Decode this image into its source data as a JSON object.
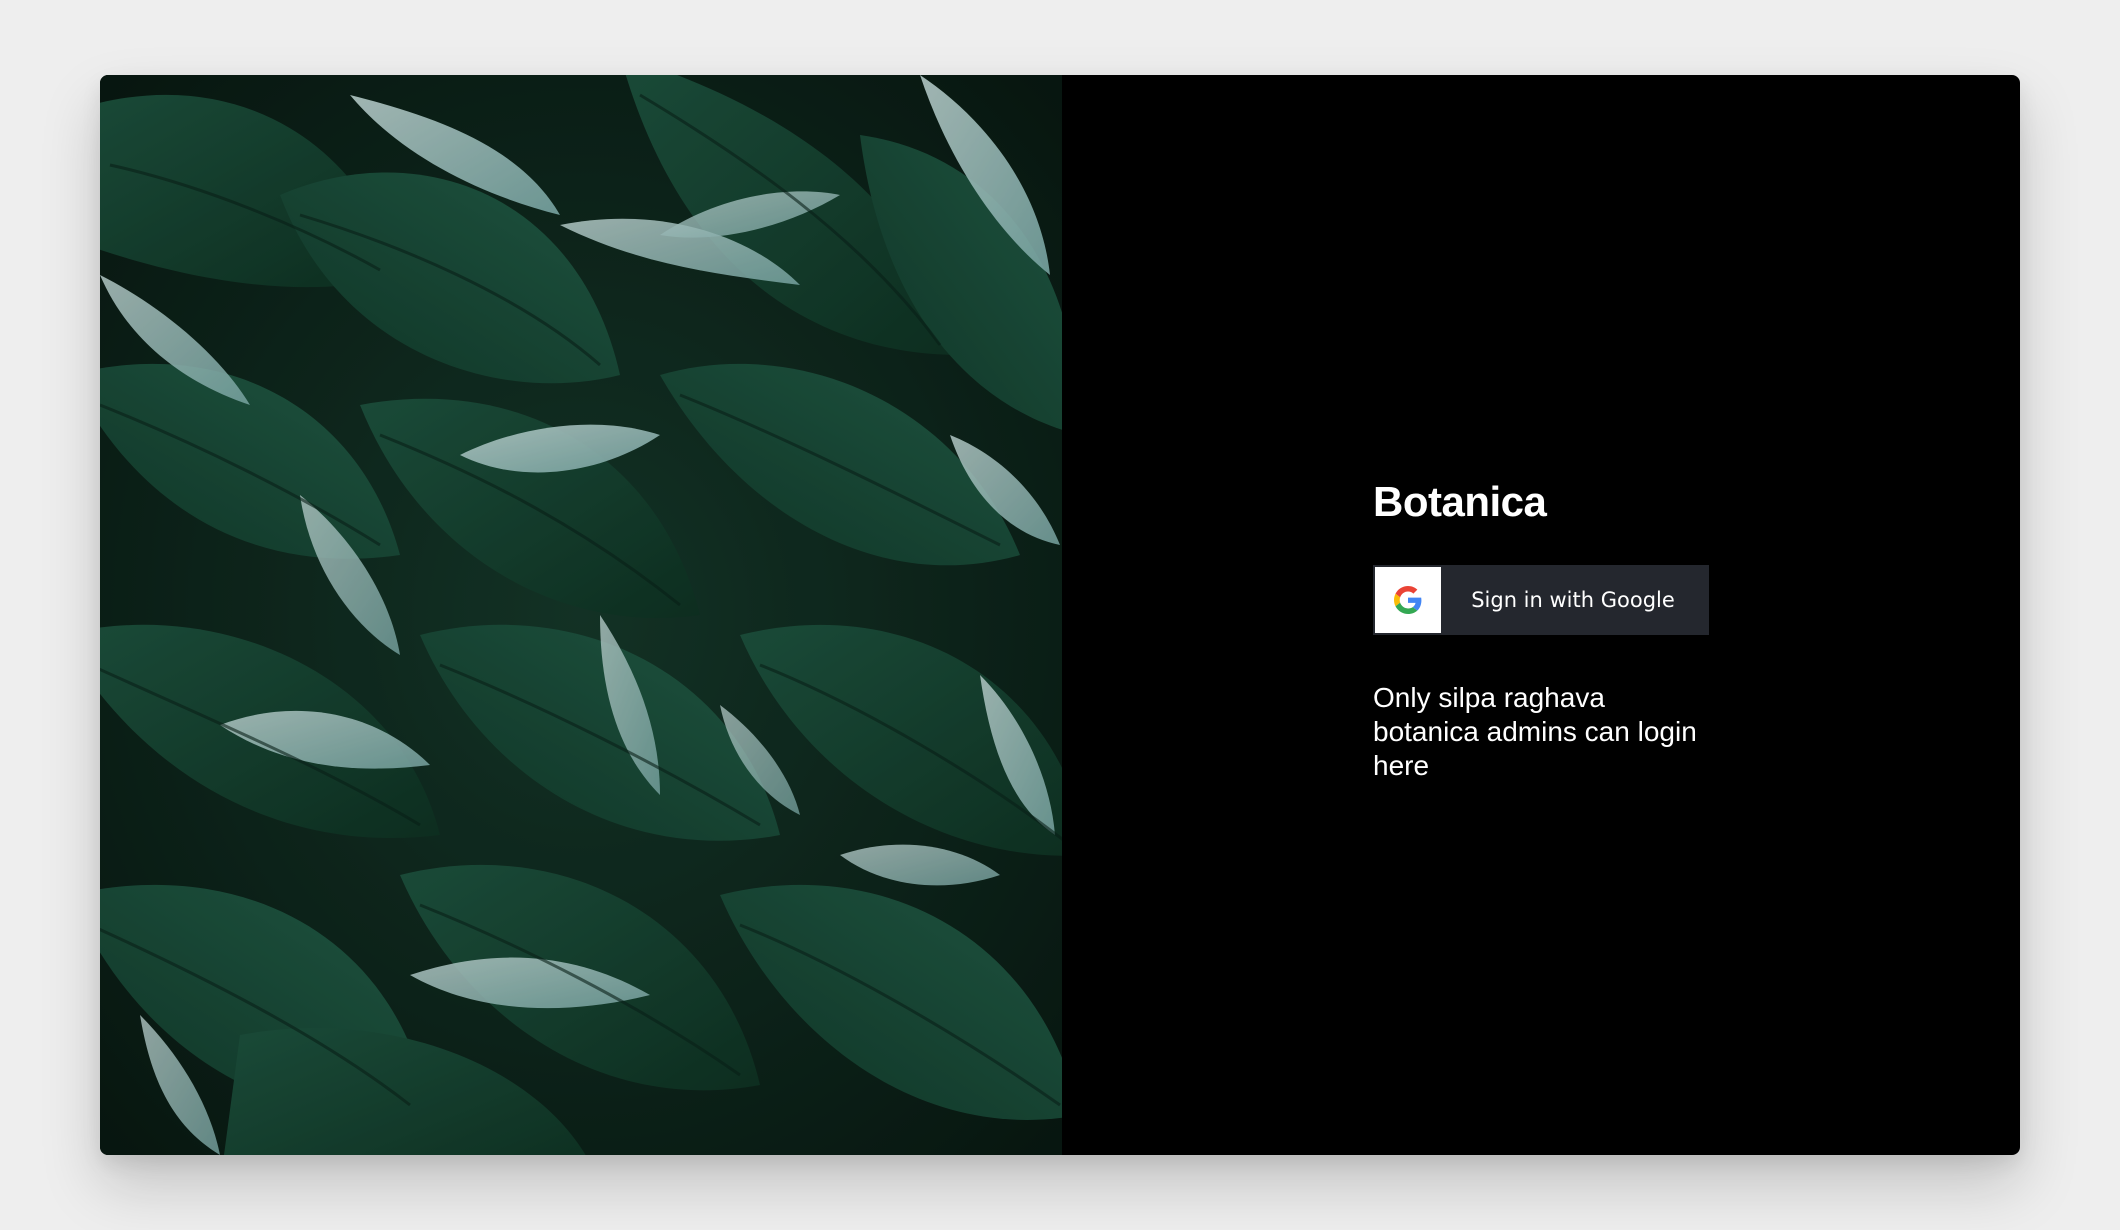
{
  "brand": {
    "title": "Botanica"
  },
  "signin": {
    "google_label": "Sign in with Google",
    "icon": "google-g-icon"
  },
  "notice": {
    "text": "Only silpa raghava botanica admins can login here"
  },
  "colors": {
    "page_background": "#eeeeee",
    "panel_background": "#000000",
    "button_background": "#24272e",
    "button_text": "#ffffff",
    "foliage_dark": "#143a2b",
    "foliage_light": "#a9d3d2"
  }
}
